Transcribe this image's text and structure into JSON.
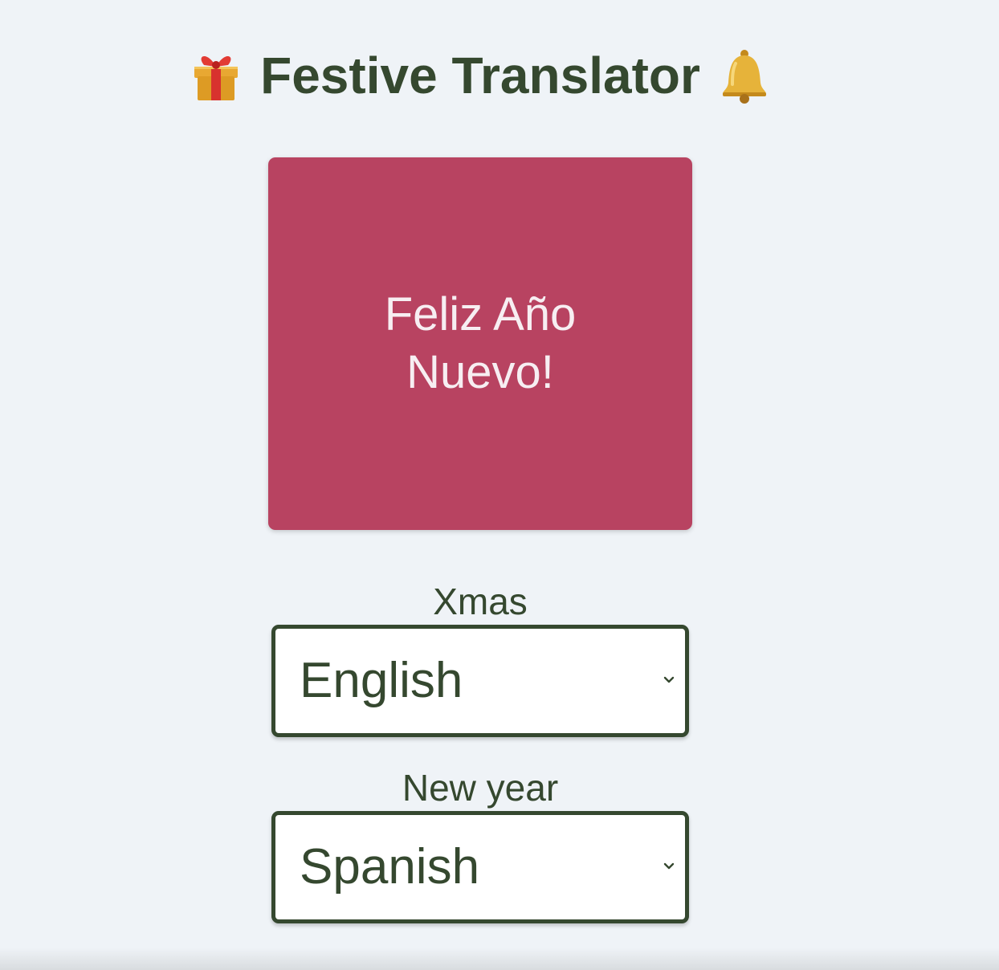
{
  "header": {
    "title": "Festive Translator",
    "left_icon": "gift-icon",
    "right_icon": "bell-icon"
  },
  "greeting_card": {
    "text": "Feliz Año Nuevo!",
    "background_color": "#b84361"
  },
  "holiday_field": {
    "label": "Xmas",
    "selected": "English"
  },
  "language_field": {
    "label": "New year",
    "selected": "Spanish"
  },
  "colors": {
    "text": "#35482f",
    "background": "#eff3f7",
    "card": "#b84361"
  }
}
